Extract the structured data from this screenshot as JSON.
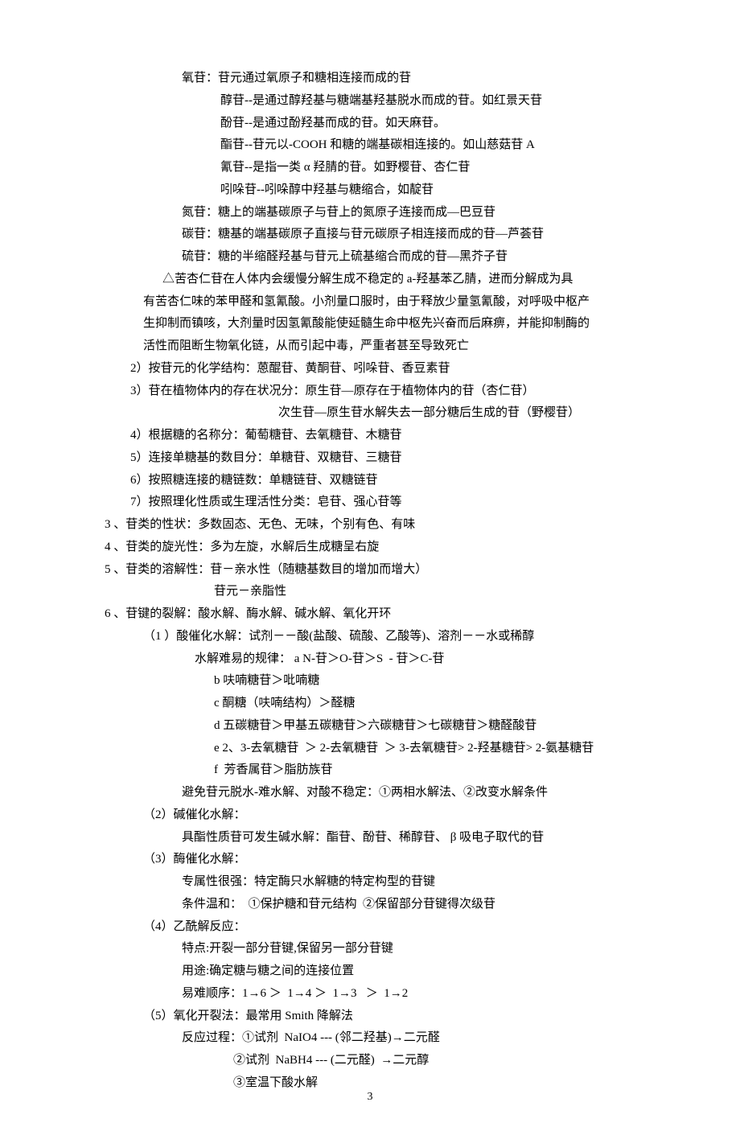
{
  "lines": [
    {
      "cls": "ind1",
      "text": "氧苷：苷元通过氧原子和糖相连接而成的苷"
    },
    {
      "cls": "ind2",
      "text": "醇苷--是通过醇羟基与糖端基羟基脱水而成的苷。如红景天苷"
    },
    {
      "cls": "ind2",
      "text": "酚苷--是通过酚羟基而成的苷。如天麻苷。"
    },
    {
      "cls": "ind2",
      "text": "酯苷--苷元以-COOH 和糖的端基碳相连接的。如山慈菇苷 A"
    },
    {
      "cls": "ind2",
      "text": "氰苷--是指一类 α 羟腈的苷。如野樱苷、杏仁苷"
    },
    {
      "cls": "ind2",
      "text": "吲哚苷--吲哚醇中羟基与糖缩合，如靛苷"
    },
    {
      "cls": "ind1",
      "text": "氮苷：糖上的端基碳原子与苷上的氮原子连接而成—巴豆苷"
    },
    {
      "cls": "ind1",
      "text": "碳苷：糖基的端基碳原子直接与苷元碳原子相连接而成的苷—芦荟苷"
    },
    {
      "cls": "ind1",
      "text": "硫苷：糖的半缩醛羟基与苷元上硫基缩合而成的苷—黑芥子苷"
    },
    {
      "cls": "ind3",
      "text": "△苦杏仁苷在人体内会缓慢分解生成不稳定的 a-羟基苯乙腈，进而分解成为具"
    },
    {
      "cls": "ind4",
      "text": "有苦杏仁味的苯甲醛和氢氰酸。小剂量口服时，由于释放少量氢氰酸，对呼吸中枢产"
    },
    {
      "cls": "ind4",
      "text": "生抑制而镇咳，大剂量时因氢氰酸能使延髓生命中枢先兴奋而后麻痹，并能抑制酶的"
    },
    {
      "cls": "ind4",
      "text": "活性而阻断生物氧化链，从而引起中毒，严重者甚至导致死亡"
    },
    {
      "cls": "ind5",
      "text": "2）按苷元的化学结构：蒽醌苷、黄酮苷、吲哚苷、香豆素苷"
    },
    {
      "cls": "ind5",
      "text": "3）苷在植物体内的存在状况分：原生苷—原存在于植物体内的苷（杏仁苷）"
    },
    {
      "cls": "ind6",
      "text": "次生苷—原生苷水解失去一部分糖后生成的苷（野樱苷）"
    },
    {
      "cls": "ind5",
      "text": "4）根据糖的名称分：葡萄糖苷、去氧糖苷、木糖苷"
    },
    {
      "cls": "ind5",
      "text": "5）连接单糖基的数目分：单糖苷、双糖苷、三糖苷"
    },
    {
      "cls": "ind5",
      "text": "6）按照糖连接的糖链数：单糖链苷、双糖链苷"
    },
    {
      "cls": "ind5",
      "text": "7）按照理化性质或生理活性分类：皂苷、强心苷等"
    },
    {
      "cls": "ind0",
      "text": "3 、苷类的性状：多数固态、无色、无味，个别有色、有味"
    },
    {
      "cls": "ind0",
      "text": "4 、苷类的旋光性：多为左旋，水解后生成糖呈右旋"
    },
    {
      "cls": "ind0",
      "text": "5 、苷类的溶解性：苷－亲水性（随糖基数目的增加而增大）"
    },
    {
      "cls": "ind9",
      "text": "苷元－亲脂性"
    },
    {
      "cls": "ind0",
      "text": "6 、苷键的裂解：酸水解、酶水解、碱水解、氧化开环"
    },
    {
      "cls": "ind7",
      "text": "（1 ）酸催化水解：试剂－－酸(盐酸、硫酸、乙酸等)、溶剂－－水或稀醇"
    },
    {
      "cls": "ind8",
      "text": "水解难易的规律： a N-苷＞O-苷＞S  - 苷＞C-苷"
    },
    {
      "cls": "ind9",
      "text": "b 呋喃糖苷＞吡喃糖"
    },
    {
      "cls": "ind9",
      "text": "c 酮糖（呋喃结构）＞醛糖"
    },
    {
      "cls": "ind9",
      "text": "d 五碳糖苷＞甲基五碳糖苷＞六碳糖苷＞七碳糖苷＞糖醛酸苷"
    },
    {
      "cls": "ind9",
      "text": "e 2、3-去氧糖苷  ＞ 2-去氧糖苷  ＞ 3-去氧糖苷> 2-羟基糖苷> 2-氨基糖苷"
    },
    {
      "cls": "ind9",
      "text": "f  芳香属苷＞脂肪族苷"
    },
    {
      "cls": "ind10",
      "text": "避免苷元脱水-难水解、对酸不稳定：①两相水解法、②改变水解条件"
    },
    {
      "cls": "ind7",
      "text": "（2）碱催化水解："
    },
    {
      "cls": "ind10",
      "text": "具酯性质苷可发生碱水解：酯苷、酚苷、稀醇苷、 β 吸电子取代的苷"
    },
    {
      "cls": "ind7",
      "text": "（3）酶催化水解："
    },
    {
      "cls": "ind10",
      "text": "专属性很强：特定酶只水解糖的特定构型的苷键"
    },
    {
      "cls": "ind10",
      "text": "条件温和：  ①保护糖和苷元结构  ②保留部分苷键得次级苷"
    },
    {
      "cls": "ind7",
      "text": "（4）乙酰解反应："
    },
    {
      "cls": "ind10",
      "text": "特点:开裂一部分苷键,保留另一部分苷键"
    },
    {
      "cls": "ind10",
      "text": "用途:确定糖与糖之间的连接位置"
    },
    {
      "cls": "ind10",
      "text": "易难顺序：1→6 ＞  1→4 ＞  1→3   ＞  1→2"
    },
    {
      "cls": "ind7",
      "text": "（5）氧化开裂法：最常用 Smith 降解法"
    },
    {
      "cls": "ind10",
      "text": "反应过程：①试剂  NaIO4 --- (邻二羟基)→二元醛"
    },
    {
      "cls": "ind11",
      "text": "②试剂  NaBH4 --- (二元醛)  →二元醇"
    },
    {
      "cls": "ind11",
      "text": "③室温下酸水解"
    }
  ],
  "page_number": "3"
}
